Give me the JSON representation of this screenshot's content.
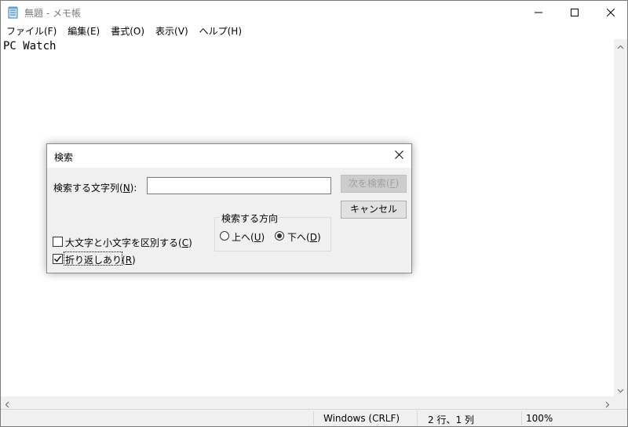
{
  "window": {
    "title": "無題 - メモ帳"
  },
  "menu": [
    {
      "label": "ファイル(F)"
    },
    {
      "label": "編集(E)"
    },
    {
      "label": "書式(O)"
    },
    {
      "label": "表示(V)"
    },
    {
      "label": "ヘルプ(H)"
    }
  ],
  "editor": {
    "text": "PC Watch"
  },
  "status": {
    "encoding": "Windows (CRLF)",
    "position": "2 行、1 列",
    "zoom": "100%"
  },
  "dialog": {
    "title": "検索",
    "find_label_prefix": "検索する文字列(",
    "find_label_key": "N",
    "find_label_suffix": "):",
    "find_value": "",
    "find_next_prefix": "次を検索(",
    "find_next_key": "F",
    "find_next_suffix": ")",
    "cancel_label": "キャンセル",
    "direction_label": "検索する方向",
    "up_prefix": "上へ(",
    "up_key": "U",
    "up_suffix": ")",
    "down_prefix": "下へ(",
    "down_key": "D",
    "down_suffix": ")",
    "direction_selected": "down",
    "match_case_prefix": "大文字と小文字を区別する(",
    "match_case_key": "C",
    "match_case_suffix": ")",
    "match_case_checked": false,
    "wrap_prefix": "折り返しあり(",
    "wrap_key": "R",
    "wrap_suffix": ")",
    "wrap_checked": true
  }
}
